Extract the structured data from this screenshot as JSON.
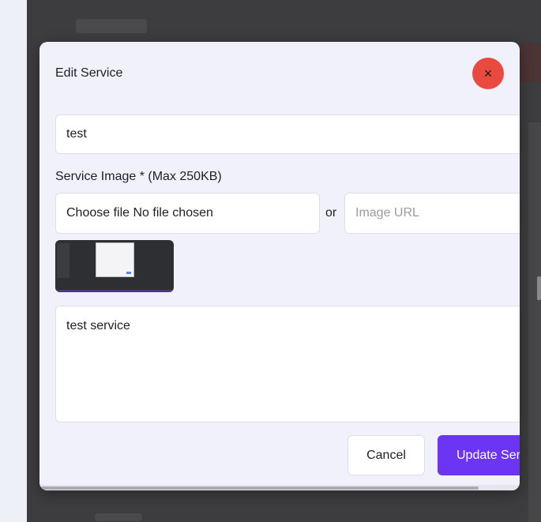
{
  "modal": {
    "title": "Edit Service",
    "close_symbol": "×",
    "name_value": "test",
    "image_label": "Service Image * (Max 250KB)",
    "file_input_text": "Choose file No file chosen",
    "or_text": "or",
    "image_url_placeholder": "Image URL",
    "description_value": "test service",
    "cancel_label": "Cancel",
    "update_label": "Update Service"
  },
  "colors": {
    "accent": "#6c35f4",
    "close": "#e84a3f",
    "backdrop": "#3d3d3f"
  },
  "icons": {
    "close": "close-icon"
  }
}
